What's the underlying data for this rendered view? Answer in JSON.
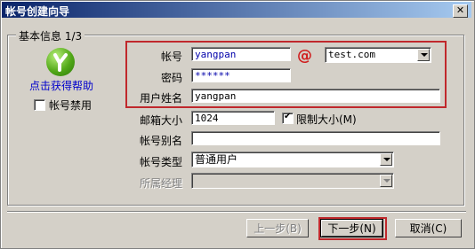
{
  "window": {
    "title": "帐号创建向导",
    "close_glyph": "✕"
  },
  "group": {
    "label": "基本信息 1/3"
  },
  "sidebar": {
    "help_link": "点击获得帮助",
    "disable_account_label": "帐号禁用",
    "disable_account_checked": false
  },
  "form": {
    "account_label": "帐号",
    "account_value": "yangpan",
    "at_symbol": "@",
    "domain_value": "test.com",
    "password_label": "密码",
    "password_value": "******",
    "username_label": "用户姓名",
    "username_value": "yangpan",
    "mailbox_size_label": "邮箱大小",
    "mailbox_size_value": "1024",
    "limit_size_label": "限制大小(M)",
    "limit_size_checked": true,
    "alias_label": "帐号别名",
    "alias_value": "",
    "type_label": "帐号类型",
    "type_value": "普通用户",
    "manager_label": "所属经理",
    "manager_value": ""
  },
  "buttons": {
    "prev": "上一步(B)",
    "next": "下一步(N)",
    "cancel": "取消(C)"
  },
  "colors": {
    "highlight_border": "#c0282c",
    "titlebar_start": "#0a246a",
    "link": "#0000cc"
  }
}
